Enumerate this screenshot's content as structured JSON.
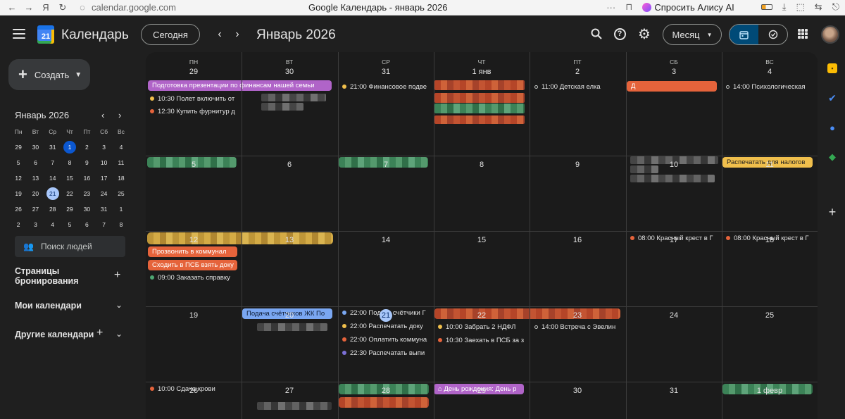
{
  "browser": {
    "url": "calendar.google.com",
    "title": "Google Календарь - январь 2026",
    "alice": "Спросить Алису AI",
    "dots": "···"
  },
  "header": {
    "app_name": "Календарь",
    "logo_day": "21",
    "today_label": "Сегодня",
    "month_title": "Январь 2026",
    "view_label": "Месяц",
    "prev": "‹",
    "next": "›"
  },
  "sidebar": {
    "create_label": "Создать",
    "mini_title": "Январь 2026",
    "mini_weekdays": [
      "Пн",
      "Вт",
      "Ср",
      "Чт",
      "Пт",
      "Сб",
      "Вс"
    ],
    "mini_days": [
      "29",
      "30",
      "31",
      "1",
      "2",
      "3",
      "4",
      "5",
      "6",
      "7",
      "8",
      "9",
      "10",
      "11",
      "12",
      "13",
      "14",
      "15",
      "16",
      "17",
      "18",
      "19",
      "20",
      "21",
      "22",
      "23",
      "24",
      "25",
      "26",
      "27",
      "28",
      "29",
      "30",
      "31",
      "1",
      "2",
      "3",
      "4",
      "5",
      "6",
      "7",
      "8"
    ],
    "search_people": "Поиск людей",
    "booking_pages": "Страницы бронирования",
    "my_calendars": "Мои календари",
    "other_calendars": "Другие календари"
  },
  "calendar": {
    "weekdays": [
      "ПН",
      "ВТ",
      "СР",
      "ЧТ",
      "ПТ",
      "СБ",
      "ВС"
    ],
    "weeks": [
      [
        "29",
        "30",
        "31",
        "1 янв",
        "2",
        "3",
        "4"
      ],
      [
        "5",
        "6",
        "7",
        "8",
        "9",
        "10",
        "11"
      ],
      [
        "12",
        "13",
        "14",
        "15",
        "16",
        "17",
        "18"
      ],
      [
        "19",
        "20",
        "21",
        "22",
        "23",
        "24",
        "25"
      ],
      [
        "26",
        "27",
        "28",
        "29",
        "30",
        "31",
        "1 февр"
      ]
    ],
    "events": {
      "w1_bar_presentation": "Подготовка презентации по финансам нашей семьи",
      "w1_mon_1": "10:30 Полет включить от",
      "w1_mon_2": "12:30 Купить фурнитур д",
      "w1_wed_1": "21:00 Финансовое подве",
      "w1_fri_1": "11:00 Детская елка",
      "w1_sat_bar": "Д",
      "w1_sun_1": "14:00 Психологическая",
      "w2_sun_bar": "Распечатать для налогов",
      "w3_mon_bar1": "Прозвонить в коммунал",
      "w3_mon_bar2": "Сходить в ПСБ взять доку",
      "w3_mon_1": "09:00 Заказать справку",
      "w3_sat_1": "08:00 Красный крест в Г",
      "w3_sun_1": "08:00 Красный крест в Г",
      "w4_tue_bar": "Подача счётчиков ЖК По",
      "w4_wed_1": "22:00 Подать счётчики Г",
      "w4_wed_2": "22:00 Распечатать доку",
      "w4_wed_3": "22:00 Оплатить коммуна",
      "w4_wed_4": "22:30 Распечатать выпи",
      "w4_thu_1": "10:00 Забрать 2 НДФЛ",
      "w4_thu_2": "10:30 Заехать в ПСБ за з",
      "w4_fri_1": "14:00 Встреча с Эвелин",
      "w5_mon_1": "10:00 Сдача крови",
      "w5_thu_bar": "День рождения: День р"
    }
  },
  "colors": {
    "purple": "#b064c8",
    "orange": "#e5633b",
    "green": "#4ea672",
    "yellow": "#f0bf4c",
    "blue": "#7aa7f2",
    "accent": "#a8c7fa"
  }
}
